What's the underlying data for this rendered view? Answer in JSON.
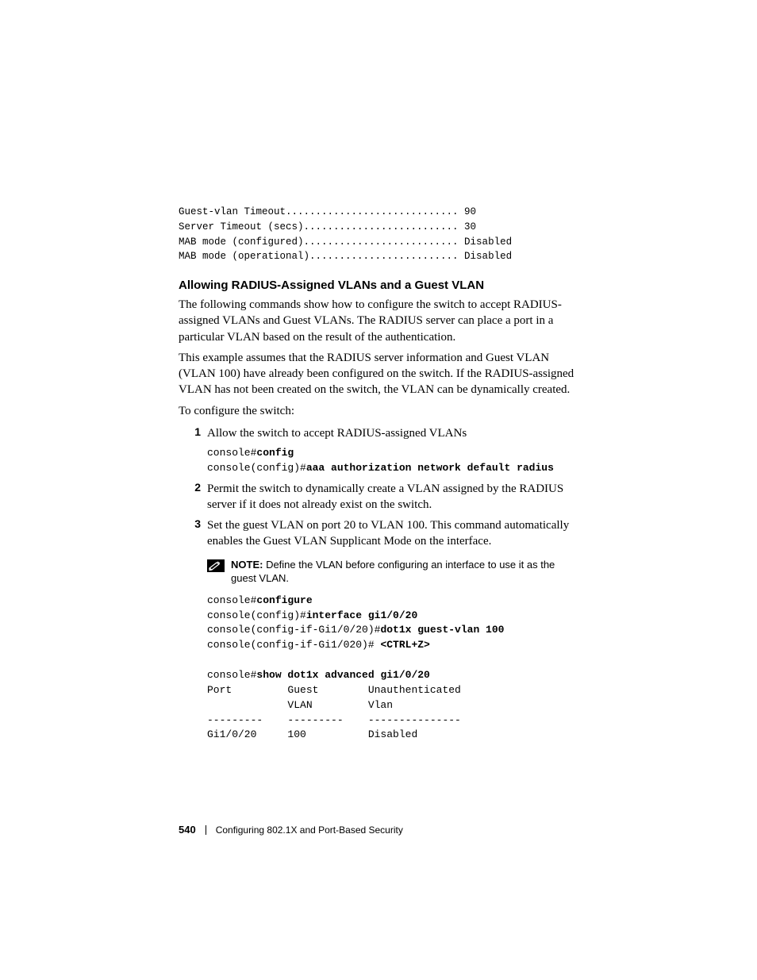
{
  "preformatted": {
    "lines": "Guest-vlan Timeout............................. 90\nServer Timeout (secs).......................... 30\nMAB mode (configured).......................... Disabled\nMAB mode (operational)......................... Disabled"
  },
  "heading": "Allowing RADIUS-Assigned VLANs and a Guest VLAN",
  "para1": "The following commands show how to configure the switch to accept RADIUS-assigned VLANs and Guest VLANs. The RADIUS server can place a port in a particular VLAN based on the result of the authentication.",
  "para2": "This example assumes that the RADIUS server information and Guest VLAN (VLAN 100) have already been configured on the switch. If the RADIUS-assigned VLAN has not been created on the switch, the VLAN can be dynamically created.",
  "para3": "To configure the switch:",
  "steps": [
    {
      "num": "1",
      "text": "Allow the switch to accept RADIUS-assigned VLANs",
      "code": {
        "p1a": "console#",
        "p1b": "config",
        "p2a": "console(config)#",
        "p2b": "aaa authorization network default radius"
      }
    },
    {
      "num": "2",
      "text": "Permit the switch to dynamically create a VLAN assigned by the RADIUS server if it does not already exist on the switch."
    },
    {
      "num": "3",
      "text": "Set the guest VLAN on port 20 to VLAN 100. This command automatically enables the Guest VLAN Supplicant Mode on the interface."
    }
  ],
  "note": {
    "label": "NOTE:",
    "text": " Define the VLAN before configuring an interface to use it as the guest VLAN."
  },
  "code2": {
    "l1a": "console#",
    "l1b": "configure",
    "l2a": "console(config)#",
    "l2b": "interface gi1/0/20",
    "l3a": "console(config-if-Gi1/0/20)#",
    "l3b": "dot1x guest-vlan 100",
    "l4a": "console(config-if-Gi1/020)# ",
    "l4b": "<CTRL+Z>",
    "blank": "",
    "l5a": "console#",
    "l5b": "show dot1x advanced gi1/0/20",
    "l6": "Port         Guest        Unauthenticated",
    "l7": "             VLAN         Vlan",
    "l8": "---------    ---------    ---------------",
    "l9": "Gi1/0/20     100          Disabled"
  },
  "footer": {
    "page": "540",
    "chapter": "Configuring 802.1X and Port-Based Security"
  }
}
